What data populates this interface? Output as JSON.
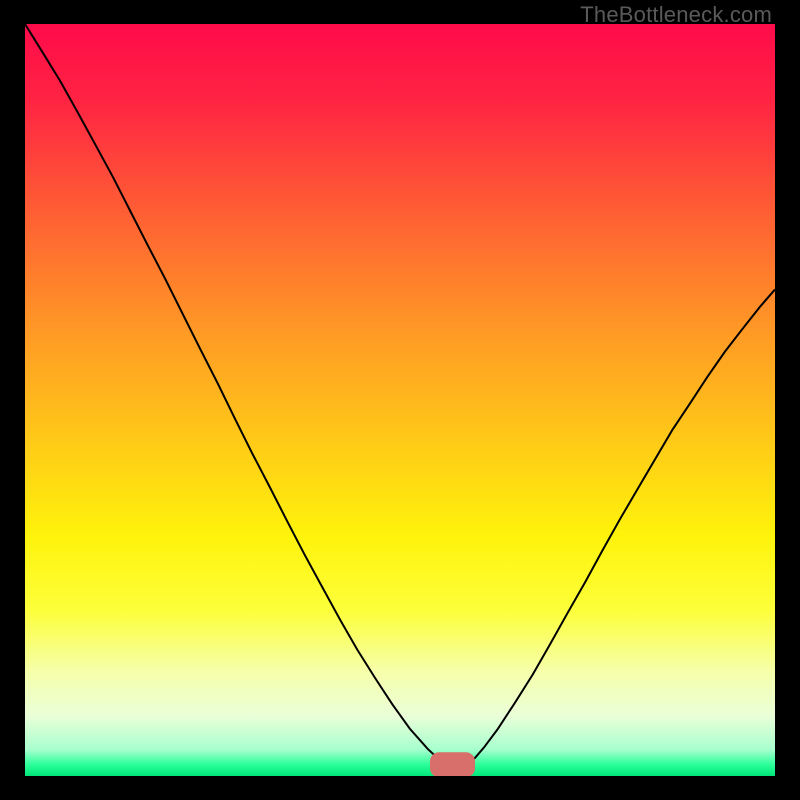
{
  "watermark": "TheBottleneck.com",
  "chart_data": {
    "type": "line",
    "title": "",
    "xlabel": "",
    "ylabel": "",
    "xlim": [
      0,
      100
    ],
    "ylim": [
      0,
      100
    ],
    "grid": false,
    "legend": false,
    "background": {
      "type": "vertical-gradient",
      "stops": [
        {
          "pos": 0.0,
          "color": "#ff0b4a"
        },
        {
          "pos": 0.1,
          "color": "#ff2343"
        },
        {
          "pos": 0.25,
          "color": "#ff5e34"
        },
        {
          "pos": 0.4,
          "color": "#ff9626"
        },
        {
          "pos": 0.55,
          "color": "#ffc818"
        },
        {
          "pos": 0.68,
          "color": "#fff30b"
        },
        {
          "pos": 0.78,
          "color": "#fcff3a"
        },
        {
          "pos": 0.86,
          "color": "#f6ffa9"
        },
        {
          "pos": 0.92,
          "color": "#eaffd8"
        },
        {
          "pos": 0.965,
          "color": "#a7ffce"
        },
        {
          "pos": 0.985,
          "color": "#2aff99"
        },
        {
          "pos": 1.0,
          "color": "#00e57b"
        }
      ]
    },
    "marker": {
      "shape": "rounded-rect",
      "color": "#d96f6a",
      "x": 57,
      "y": 1.5,
      "w": 6,
      "h": 3.3
    },
    "series": [
      {
        "name": "bottleneck-curve",
        "color": "#000000",
        "stroke_width": 2,
        "x": [
          0.0,
          2.3,
          4.7,
          7.0,
          9.3,
          11.7,
          14.0,
          16.3,
          18.7,
          21.0,
          23.3,
          25.7,
          28.0,
          30.3,
          32.7,
          35.0,
          37.3,
          39.7,
          42.0,
          44.3,
          46.7,
          49.0,
          51.3,
          53.7,
          55.0,
          56.0,
          57.0,
          58.0,
          59.0,
          60.0,
          61.2,
          63.0,
          65.3,
          67.7,
          70.0,
          72.3,
          74.7,
          77.0,
          79.3,
          81.7,
          84.0,
          86.3,
          88.7,
          91.0,
          93.3,
          95.7,
          98.0,
          100.0
        ],
        "y": [
          100.0,
          96.3,
          92.4,
          88.3,
          84.1,
          79.7,
          75.2,
          70.7,
          66.1,
          61.5,
          56.9,
          52.2,
          47.5,
          42.9,
          38.3,
          33.8,
          29.4,
          25.0,
          20.8,
          16.8,
          13.0,
          9.5,
          6.3,
          3.6,
          2.4,
          1.6,
          1.2,
          1.2,
          1.6,
          2.4,
          3.8,
          6.2,
          9.7,
          13.5,
          17.5,
          21.6,
          25.8,
          30.0,
          34.1,
          38.2,
          42.1,
          46.0,
          49.6,
          53.1,
          56.4,
          59.5,
          62.4,
          64.7
        ]
      }
    ]
  }
}
